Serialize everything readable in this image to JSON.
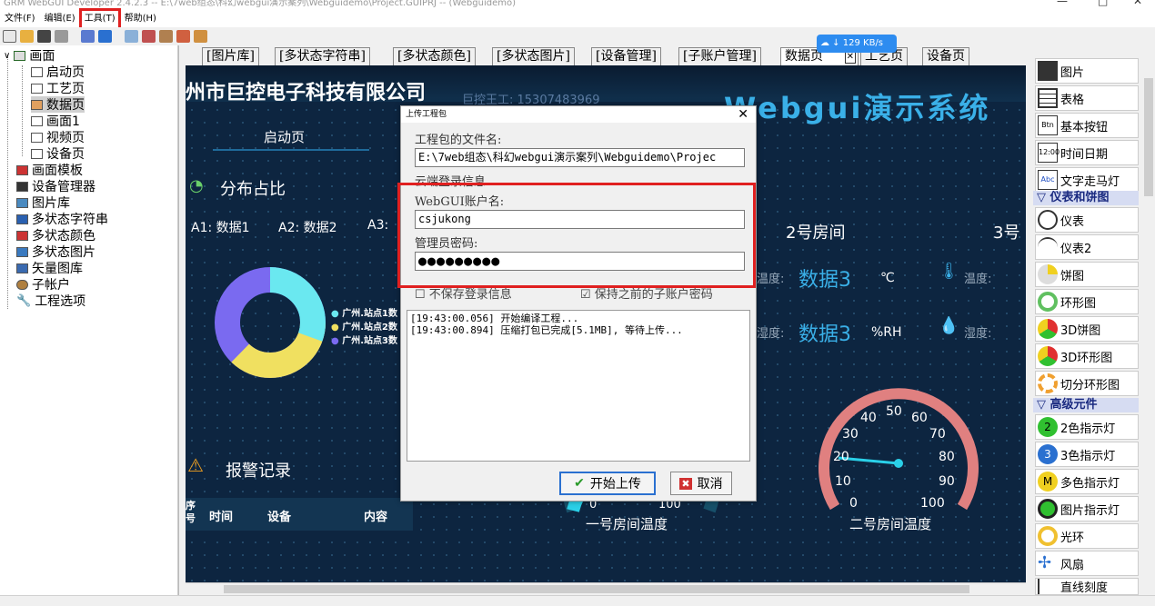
{
  "window": {
    "title": "GRM WebGUI Developer 2.4.2.3 -- E:\\7web组态\\科幻webgui演示案列\\Webguidemo\\Project.GUIPRJ -- (Webguidemo)"
  },
  "menu": [
    "文件(F)",
    "编辑(E)",
    "工具(T)",
    "帮助(H)"
  ],
  "tree": {
    "root": "画面",
    "pages": [
      "启动页",
      "工艺页",
      "数据页",
      "画面1",
      "视频页",
      "设备页"
    ],
    "others": [
      "画面模板",
      "设备管理器",
      "图片库",
      "多状态字符串",
      "多状态颜色",
      "多状态图片",
      "矢量图库",
      "子帐户",
      "工程选项"
    ]
  },
  "tabs": [
    "[图片库]",
    "[多状态字符串]",
    "[多状态颜色]",
    "[多状态图片]",
    "[设备管理]",
    "[子账户管理]",
    "数据页",
    "工艺页",
    "设备页"
  ],
  "net_speed": "129 KB/s",
  "canvas": {
    "company": "州市巨控电子科技有限公司",
    "contact": "巨控王工: 15307483969",
    "system_title": "Webgui演示系统",
    "nav_button": "启动页",
    "pie_title": "分布占比",
    "data_row": [
      "A1: 数据1",
      "A2: 数据2",
      "A3:"
    ],
    "legend": [
      "广州.站点1数",
      "广州.站点2数",
      "广州.站点3数"
    ],
    "alarm_title": "报警记录",
    "alarm_headers": [
      "序号",
      "时间",
      "设备",
      "内容"
    ],
    "room2": "2号房间",
    "room3": "3号",
    "temp_label": "温度:",
    "humid_label": "湿度:",
    "data3": "数据3",
    "unit_c": "℃",
    "unit_rh": "%RH",
    "temp_label2": "温度:",
    "humid_label2": "湿度:",
    "gauge1_label": "一号房间温度",
    "gauge1_ticks": [
      "0",
      "100"
    ],
    "gauge2_label": "二号房间温度",
    "gauge2_ticks": [
      "0",
      "10",
      "20",
      "30",
      "40",
      "50",
      "60",
      "70",
      "80",
      "90",
      "100"
    ]
  },
  "components": {
    "items1": [
      "图片",
      "表格",
      "基本按钮",
      "时间日期",
      "文字走马灯"
    ],
    "section2": "仪表和饼图",
    "items2": [
      "仪表",
      "仪表2",
      "饼图",
      "环形图",
      "3D饼图",
      "3D环形图",
      "切分环形图"
    ],
    "section3": "高级元件",
    "items3": [
      "2色指示灯",
      "3色指示灯",
      "多色指示灯",
      "图片指示灯",
      "光环",
      "风扇",
      "直线刻度"
    ]
  },
  "dialog": {
    "title": "上传工程包",
    "file_label": "工程包的文件名:",
    "file_path": "E:\\7web组态\\科幻webgui演示案列\\Webguidemo\\Projec",
    "cloud_label": "云端登录信息",
    "account_label": "WebGUI账户名:",
    "account_value": "csjukong",
    "password_label": "管理员密码:",
    "password_value": "●●●●●●●●●",
    "no_save_label": "不保存登录信息",
    "keep_label": "保持之前的子账户密码",
    "log": [
      "[19:43:00.056] 开始编译工程...",
      "[19:43:00.894] 压缩打包已完成[5.1MB], 等待上传..."
    ],
    "start_button": "开始上传",
    "cancel_button": "取消"
  }
}
